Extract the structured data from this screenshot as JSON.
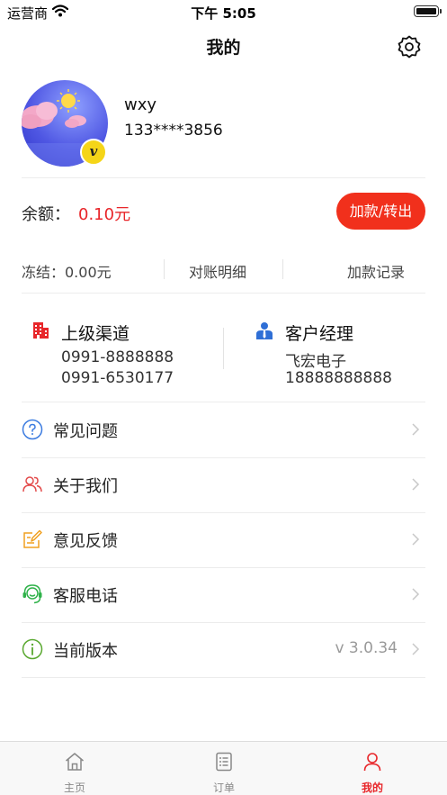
{
  "status_bar": {
    "carrier": "运营商",
    "time": "下午 5:05"
  },
  "nav": {
    "title": "我的",
    "settings_icon": "settings-icon"
  },
  "profile": {
    "name": "wxy",
    "phone": "133****3856",
    "badge": "v"
  },
  "balance": {
    "label": "余额：",
    "value": "0.10元",
    "transfer_label": "加款/转出"
  },
  "account_links": {
    "frozen": "冻结：0.00元",
    "statement": "对账明细",
    "deposit_records": "加款记录"
  },
  "contacts": {
    "channel": {
      "title": "上级渠道",
      "lines": [
        "0991-8888888",
        "0991-6530177"
      ]
    },
    "manager": {
      "title": "客户经理",
      "lines": [
        "飞宏电子",
        "18888888888"
      ]
    }
  },
  "menu": [
    {
      "label": "常见问题",
      "icon": "help-icon",
      "value": ""
    },
    {
      "label": "关于我们",
      "icon": "users-icon",
      "value": ""
    },
    {
      "label": "意见反馈",
      "icon": "feedback-icon",
      "value": ""
    },
    {
      "label": "客服电话",
      "icon": "headset-icon",
      "value": ""
    },
    {
      "label": "当前版本",
      "icon": "info-icon",
      "value": "v 3.0.34"
    }
  ],
  "tabs": [
    {
      "label": "主页",
      "icon": "home-icon"
    },
    {
      "label": "订单",
      "icon": "orders-icon"
    },
    {
      "label": "我的",
      "icon": "profile-icon",
      "active": true
    }
  ],
  "colors": {
    "accent": "#f1301c",
    "price": "#e8262a",
    "help": "#3b7be0",
    "about": "#e34b4b",
    "feedback": "#f0a020",
    "service": "#2fb24a",
    "version": "#59a82f"
  }
}
